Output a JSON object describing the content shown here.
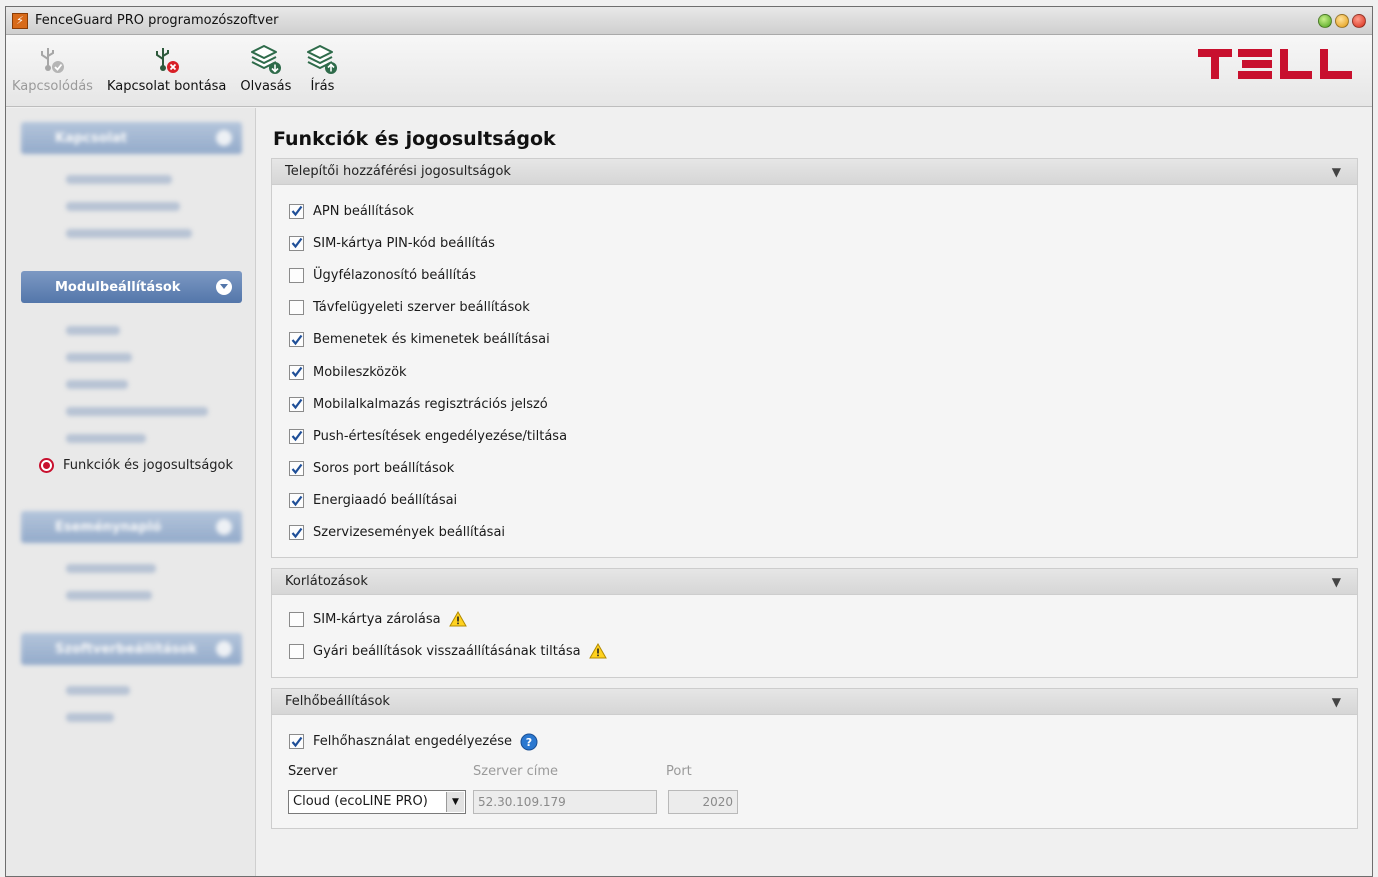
{
  "window": {
    "title": "FenceGuard PRO programozószoftver",
    "app_icon_glyph": "⚡"
  },
  "toolbar": {
    "connect_label": "Kapcsolódás",
    "disconnect_label": "Kapcsolat bontása",
    "read_label": "Olvasás",
    "write_label": "Írás"
  },
  "logo": {
    "text": "TELL",
    "color": "#c8102e"
  },
  "sidebar": {
    "groups": [
      {
        "label": "Kapcsolat",
        "items": [
          "Kapcsolódás mód",
          "Fiókazonosítók",
          "Szerver jelszavak"
        ]
      },
      {
        "label": "Modulbeállítások",
        "items": [
          "Általános",
          "Bemenetek",
          "Kimenetek",
          "Energiaadó beállításai",
          "Hatásköreik"
        ],
        "current": "Funkciók és jogosultságok"
      },
      {
        "label": "Eseménynapló",
        "items": [
          "Napló lekérése",
          "Eseménynapló"
        ]
      },
      {
        "label": "Szoftverbeállítások",
        "items": [
          "Beállítások",
          "Súgó"
        ]
      }
    ]
  },
  "main": {
    "title": "Funkciók és jogosultságok",
    "panels": {
      "installer": {
        "title": "Telepítői hozzáférési jogosultságok",
        "items": [
          {
            "label": "APN beállítások",
            "checked": true
          },
          {
            "label": "SIM-kártya PIN-kód beállítás",
            "checked": true
          },
          {
            "label": "Ügyfélazonosító beállítás",
            "checked": false
          },
          {
            "label": "Távfelügyeleti szerver beállítások",
            "checked": false
          },
          {
            "label": "Bemenetek és kimenetek beállításai",
            "checked": true
          },
          {
            "label": "Mobileszközök",
            "checked": true
          },
          {
            "label": "Mobilalkalmazás regisztrációs jelszó",
            "checked": true
          },
          {
            "label": "Push-értesítések engedélyezése/tiltása",
            "checked": true
          },
          {
            "label": "Soros port beállítások",
            "checked": true
          },
          {
            "label": "Energiaadó beállításai",
            "checked": true
          },
          {
            "label": "Szervizesemények beállításai",
            "checked": true
          }
        ]
      },
      "restrictions": {
        "title": "Korlátozások",
        "items": [
          {
            "label": "SIM-kártya zárolása",
            "checked": false,
            "icon": "warning-icon"
          },
          {
            "label": "Gyári beállítások visszaállításának tiltása",
            "checked": false,
            "icon": "warning-icon"
          }
        ]
      },
      "cloud": {
        "title": "Felhőbeállítások",
        "enable_label": "Felhőhasználat engedélyezése",
        "enable_checked": true,
        "server_label": "Szerver",
        "server_address_label": "Szerver címe",
        "port_label": "Port",
        "server_value": "Cloud (ecoLINE PRO)",
        "server_address_value": "52.30.109.179",
        "port_value": "2020"
      }
    }
  }
}
